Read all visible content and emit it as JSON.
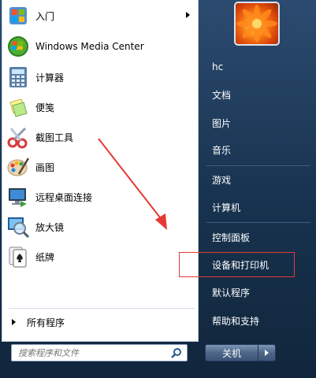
{
  "left_panel": {
    "items": [
      {
        "label": "入门",
        "icon": "getting-started-icon",
        "has_submenu": true
      },
      {
        "label": "Windows Media Center",
        "icon": "windows-media-center-icon"
      },
      {
        "label": "计算器",
        "icon": "calculator-icon"
      },
      {
        "label": "便笺",
        "icon": "sticky-notes-icon"
      },
      {
        "label": "截图工具",
        "icon": "snipping-tool-icon"
      },
      {
        "label": "画图",
        "icon": "paint-icon"
      },
      {
        "label": "远程桌面连接",
        "icon": "remote-desktop-icon"
      },
      {
        "label": "放大镜",
        "icon": "magnifier-icon"
      },
      {
        "label": "纸牌",
        "icon": "solitaire-icon"
      }
    ],
    "all_programs_label": "所有程序"
  },
  "search": {
    "placeholder": "搜索程序和文件"
  },
  "right_panel": {
    "items": [
      {
        "label": "hc"
      },
      {
        "label": "文档"
      },
      {
        "label": "图片"
      },
      {
        "label": "音乐"
      },
      {
        "label": "游戏"
      },
      {
        "label": "计算机"
      },
      {
        "label": "控制面板"
      },
      {
        "label": "设备和打印机",
        "highlighted": true
      },
      {
        "label": "默认程序"
      },
      {
        "label": "帮助和支持"
      }
    ]
  },
  "shutdown": {
    "label": "关机"
  },
  "annotation": {
    "color": "#e53935",
    "highlighted_item": "设备和打印机"
  }
}
